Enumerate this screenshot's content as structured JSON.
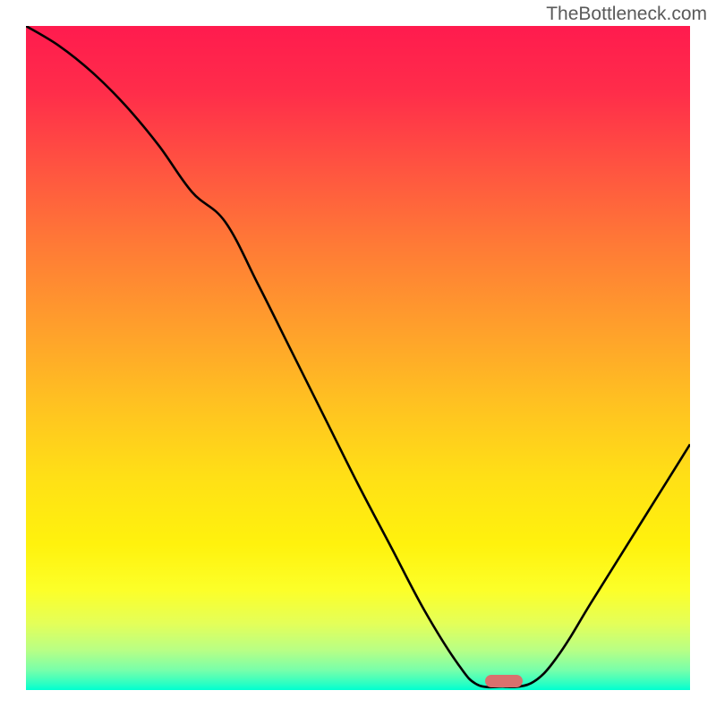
{
  "watermark": "TheBottleneck.com",
  "chart_data": {
    "type": "line",
    "title": "",
    "xlabel": "",
    "ylabel": "",
    "xlim": [
      0,
      100
    ],
    "ylim": [
      0,
      100
    ],
    "series": [
      {
        "name": "curve",
        "x": [
          0,
          5,
          10,
          15,
          20,
          25,
          30,
          35,
          40,
          45,
          50,
          55,
          60,
          65,
          68,
          72,
          74,
          76,
          78,
          80,
          82,
          85,
          90,
          95,
          100
        ],
        "y": [
          100,
          97,
          93,
          88,
          82,
          75,
          70.5,
          61,
          51,
          41,
          31,
          21.5,
          12,
          4,
          0.8,
          0.5,
          0.5,
          1,
          2.5,
          5,
          8,
          13,
          21,
          29,
          37
        ]
      }
    ],
    "marker": {
      "x": 72,
      "y": 1.3,
      "color": "#d9716e"
    },
    "gradient_from": "#ff1b4e",
    "gradient_to": "#00ffd0"
  }
}
